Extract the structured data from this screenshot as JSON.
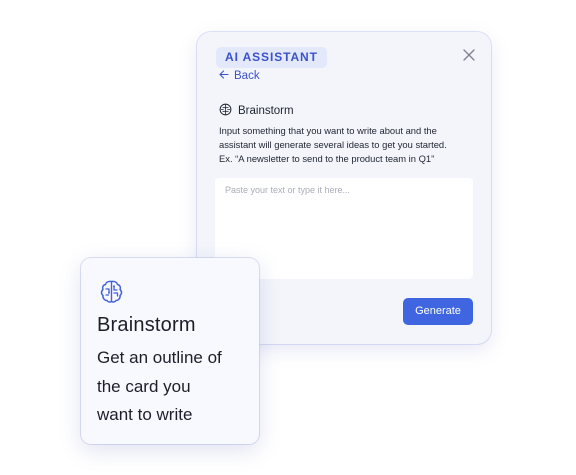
{
  "panel": {
    "tag": "AI ASSISTANT",
    "back_label": "Back",
    "section_title": "Brainstorm",
    "description_lines": [
      "Input something that you want to write about and the",
      "assistant will generate several ideas to get you started.",
      "Ex. “A newsletter to send to the product team in Q1”"
    ],
    "textarea_placeholder": "Paste your text or type it here...",
    "generate_label": "Generate"
  },
  "card": {
    "title": "Brainstorm",
    "body_lines": [
      "Get an outline of",
      "the card you",
      "want to write"
    ]
  },
  "colors": {
    "accent": "#3f66e0",
    "tag_background": "#e3e8fb",
    "tag_text": "#3b52c9",
    "panel_background": "#f3f5fb"
  },
  "icons": {
    "close": "close-icon",
    "back": "arrow-left-icon",
    "section": "brain-icon",
    "card": "brain-icon"
  }
}
